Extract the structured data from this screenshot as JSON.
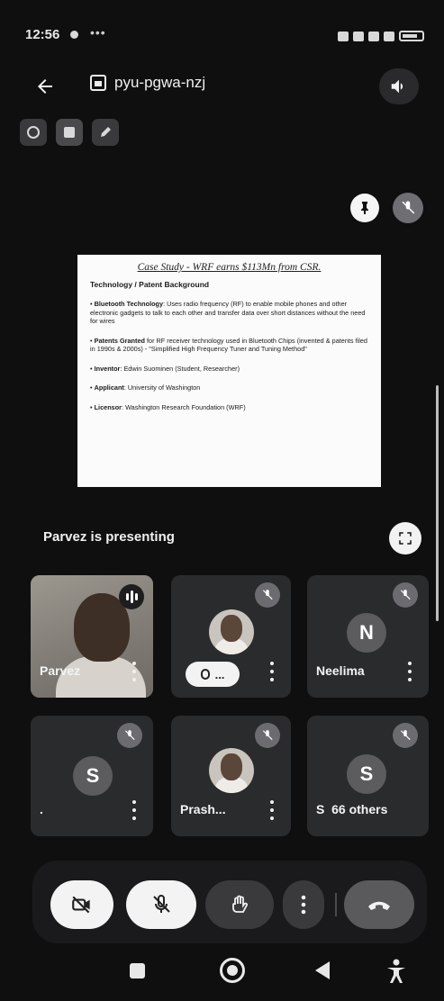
{
  "status_bar": {
    "time": "12:56",
    "more": "•••"
  },
  "header": {
    "meeting_code": "pyu-pgwa-nzj"
  },
  "slide": {
    "title": "Case Study - WRF earns $113Mn from CSR.",
    "heading": "Technology / Patent Background",
    "bullets": [
      {
        "label": "Bluetooth Technology",
        "text": ": Uses radio frequency (RF) to enable mobile phones and other electronic gadgets to talk to each other and transfer data over short distances without the need for wires"
      },
      {
        "label": "Patents Granted",
        "text": " for RF receiver technology used in Bluetooth Chips (invented & patents filed in 1990s & 2000s) - \"Simplified High Frequency Tuner and Tuning Method\""
      },
      {
        "label": "Inventor",
        "text": ": Edwin Suominen (Student, Researcher)"
      },
      {
        "label": "Applicant",
        "text": ": University of Washington"
      },
      {
        "label": "Licensor",
        "text": ": Washington Research Foundation (WRF)"
      }
    ]
  },
  "presenting_label": "Parvez is presenting",
  "participants": [
    {
      "name": "Parvez",
      "type": "photo",
      "speaking": true
    },
    {
      "name": "",
      "type": "photo",
      "chip": "...",
      "muted": true
    },
    {
      "name": "Neelima",
      "initial": "N",
      "muted": true
    },
    {
      "name": ".",
      "initial": "S",
      "muted": true
    },
    {
      "name": "Prash...",
      "type": "photo",
      "muted": true
    },
    {
      "name": "S",
      "initial": "S",
      "others": "66 others",
      "muted": true
    }
  ],
  "controls": {
    "camera": "camera-off",
    "mic": "mic-off",
    "hand": "raise-hand",
    "more": "more-options",
    "hangup": "leave-call"
  },
  "colors": {
    "background": "#0f0f10",
    "tile": "#2a2b2d",
    "button_light": "#f3f3f3"
  }
}
